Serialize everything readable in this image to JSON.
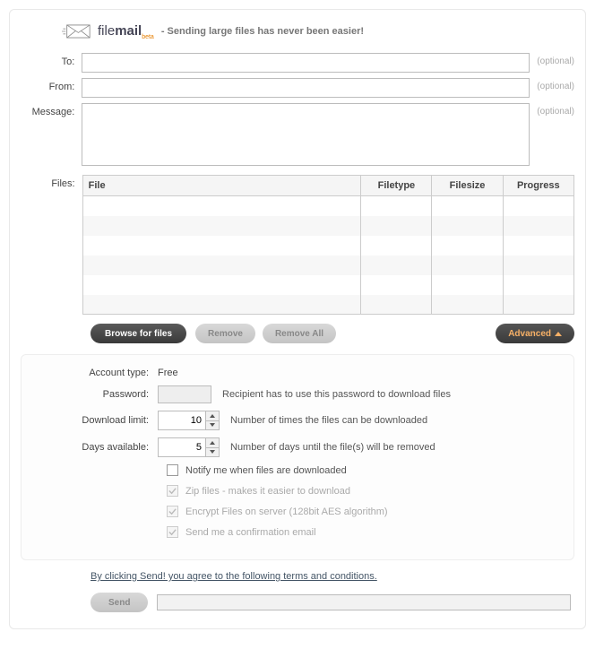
{
  "logo": {
    "file": "file",
    "mail": "mail",
    "beta": "beta"
  },
  "tagline": "- Sending large files has never been easier!",
  "labels": {
    "to": "To:",
    "from": "From:",
    "message": "Message:",
    "files": "Files:",
    "optional": "(optional)"
  },
  "table": {
    "headers": {
      "file": "File",
      "filetype": "Filetype",
      "filesize": "Filesize",
      "progress": "Progress"
    }
  },
  "buttons": {
    "browse": "Browse for files",
    "remove": "Remove",
    "remove_all": "Remove All",
    "advanced": "Advanced",
    "send": "Send"
  },
  "advanced": {
    "account_type_label": "Account type:",
    "account_type_value": "Free",
    "password_label": "Password:",
    "password_help": "Recipient has to use this password to download files",
    "download_limit_label": "Download limit:",
    "download_limit_value": "10",
    "download_limit_help": "Number of times the files can be downloaded",
    "days_label": "Days available:",
    "days_value": "5",
    "days_help": "Number of days until the file(s) will be removed",
    "notify_label": "Notify me when files are downloaded",
    "zip_label": "Zip files - makes it easier to download",
    "encrypt_label": "Encrypt Files on server (128bit AES algorithm)",
    "confirm_label": "Send me a confirmation email"
  },
  "terms": "By clicking Send! you agree to the following terms and conditions."
}
